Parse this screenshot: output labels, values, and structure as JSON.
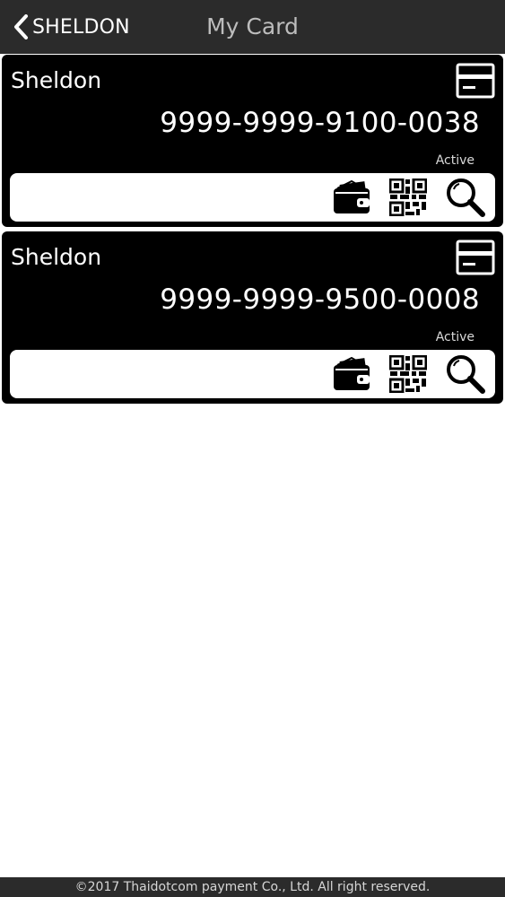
{
  "header": {
    "back_label": "SHELDON",
    "title": "My Card"
  },
  "cards": [
    {
      "holder": "Sheldon",
      "number": "9999-9999-9100-0038",
      "status": "Active"
    },
    {
      "holder": "Sheldon",
      "number": "9999-9999-9500-0008",
      "status": "Active"
    }
  ],
  "footer": {
    "copyright": "©2017 Thaidotcom payment Co., Ltd. All right reserved."
  },
  "colors": {
    "header_bg": "#2b2b2b",
    "card_bg": "#000000",
    "page_bg": "#ffffff"
  },
  "icons": {
    "back": "chevron-left-icon",
    "card": "credit-card-icon",
    "wallet": "wallet-icon",
    "qr": "qr-code-icon",
    "search": "magnifier-icon"
  }
}
